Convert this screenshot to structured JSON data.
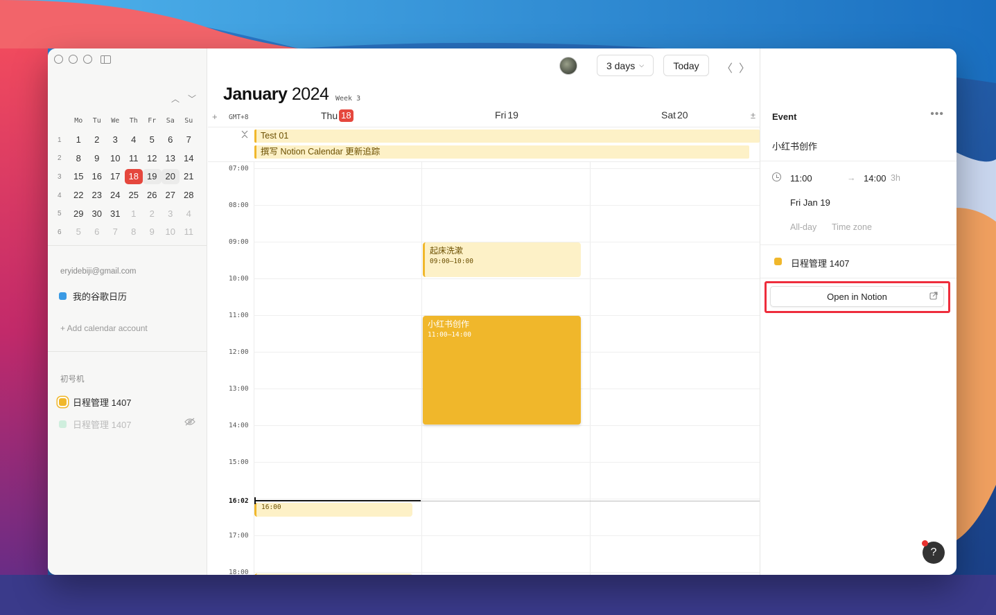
{
  "colors": {
    "accent_yellow": "#f0b72b",
    "today_red": "#e5473d",
    "google_blue": "#3a9ae4",
    "highlight_red": "#ee2d3c"
  },
  "sidebar": {
    "weekday_headers": [
      "Mo",
      "Tu",
      "We",
      "Th",
      "Fr",
      "Sa",
      "Su"
    ],
    "mini_calendar": [
      {
        "week": "1",
        "days": [
          "1",
          "2",
          "3",
          "4",
          "5",
          "6",
          "7"
        ]
      },
      {
        "week": "2",
        "days": [
          "8",
          "9",
          "10",
          "11",
          "12",
          "13",
          "14"
        ]
      },
      {
        "week": "3",
        "days": [
          "15",
          "16",
          "17",
          "18",
          "19",
          "20",
          "21"
        ]
      },
      {
        "week": "4",
        "days": [
          "22",
          "23",
          "24",
          "25",
          "26",
          "27",
          "28"
        ]
      },
      {
        "week": "5",
        "days": [
          "29",
          "30",
          "31",
          "1",
          "2",
          "3",
          "4"
        ]
      },
      {
        "week": "6",
        "days": [
          "5",
          "6",
          "7",
          "8",
          "9",
          "10",
          "11"
        ]
      }
    ],
    "account_email": "eryidebiji@gmail.com",
    "google_calendar": "我的谷歌日历",
    "add_account": "+ Add calendar account",
    "section_label": "初号机",
    "calendar_active": "日程管理 1407",
    "calendar_hidden": "日程管理 1407"
  },
  "header": {
    "view_label": "3 days",
    "today_label": "Today",
    "month": "January",
    "year": "2024",
    "week_label": "Week 3",
    "timezone": "GMT+8",
    "days": [
      {
        "name": "Thu",
        "num": "18"
      },
      {
        "name": "Fri",
        "num": "19"
      },
      {
        "name": "Sat",
        "num": "20"
      }
    ]
  },
  "allday_events": [
    {
      "title": "Test 01"
    },
    {
      "title": "撰写 Notion Calendar 更新追踪"
    }
  ],
  "hours": [
    "07:00",
    "08:00",
    "09:00",
    "10:00",
    "11:00",
    "12:00",
    "13:00",
    "14:00",
    "15:00",
    "16:02",
    "17:00",
    "18:00"
  ],
  "events": [
    {
      "title": "起床洗漱",
      "time": "09:00–10:00"
    },
    {
      "title": "小红书创作",
      "time": "11:00–14:00"
    },
    {
      "title": "",
      "time": "16:00"
    }
  ],
  "panel": {
    "title": "Event",
    "event_name": "小红书创作",
    "start": "11:00",
    "end": "14:00",
    "duration": "3h",
    "date": "Fri Jan 19",
    "allday": "All-day",
    "timezone": "Time zone",
    "calendar": "日程管理 1407",
    "open_label": "Open in Notion",
    "help": "?"
  }
}
